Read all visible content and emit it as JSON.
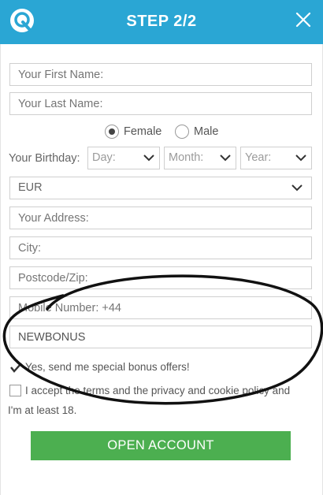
{
  "header": {
    "title": "STEP 2/2",
    "logo_icon": "q-logo-icon",
    "close_icon": "close-icon",
    "bg_color": "#2aa6d4"
  },
  "form": {
    "first_name": {
      "placeholder": "Your First Name:"
    },
    "last_name": {
      "placeholder": "Your Last Name:"
    },
    "gender": {
      "options": [
        "Female",
        "Male"
      ],
      "selected": "Female"
    },
    "birthday": {
      "label": "Your Birthday:",
      "day": "Day:",
      "month": "Month:",
      "year": "Year:"
    },
    "currency": {
      "value": "EUR"
    },
    "address": {
      "placeholder": "Your Address:"
    },
    "city": {
      "placeholder": "City:"
    },
    "postcode": {
      "placeholder": "Postcode/Zip:"
    },
    "mobile": {
      "placeholder": "Mobile Number: +44"
    },
    "bonus_code": {
      "value": "NEWBONUS"
    },
    "offers": {
      "label": "Yes, send me special bonus offers!",
      "checked": true
    },
    "terms": {
      "line1": "I accept the terms and the privacy and cookie policy and",
      "line2": "I'm at least 18.",
      "checked": false
    },
    "submit_label": "OPEN ACCOUNT",
    "button_color": "#4caf50"
  }
}
